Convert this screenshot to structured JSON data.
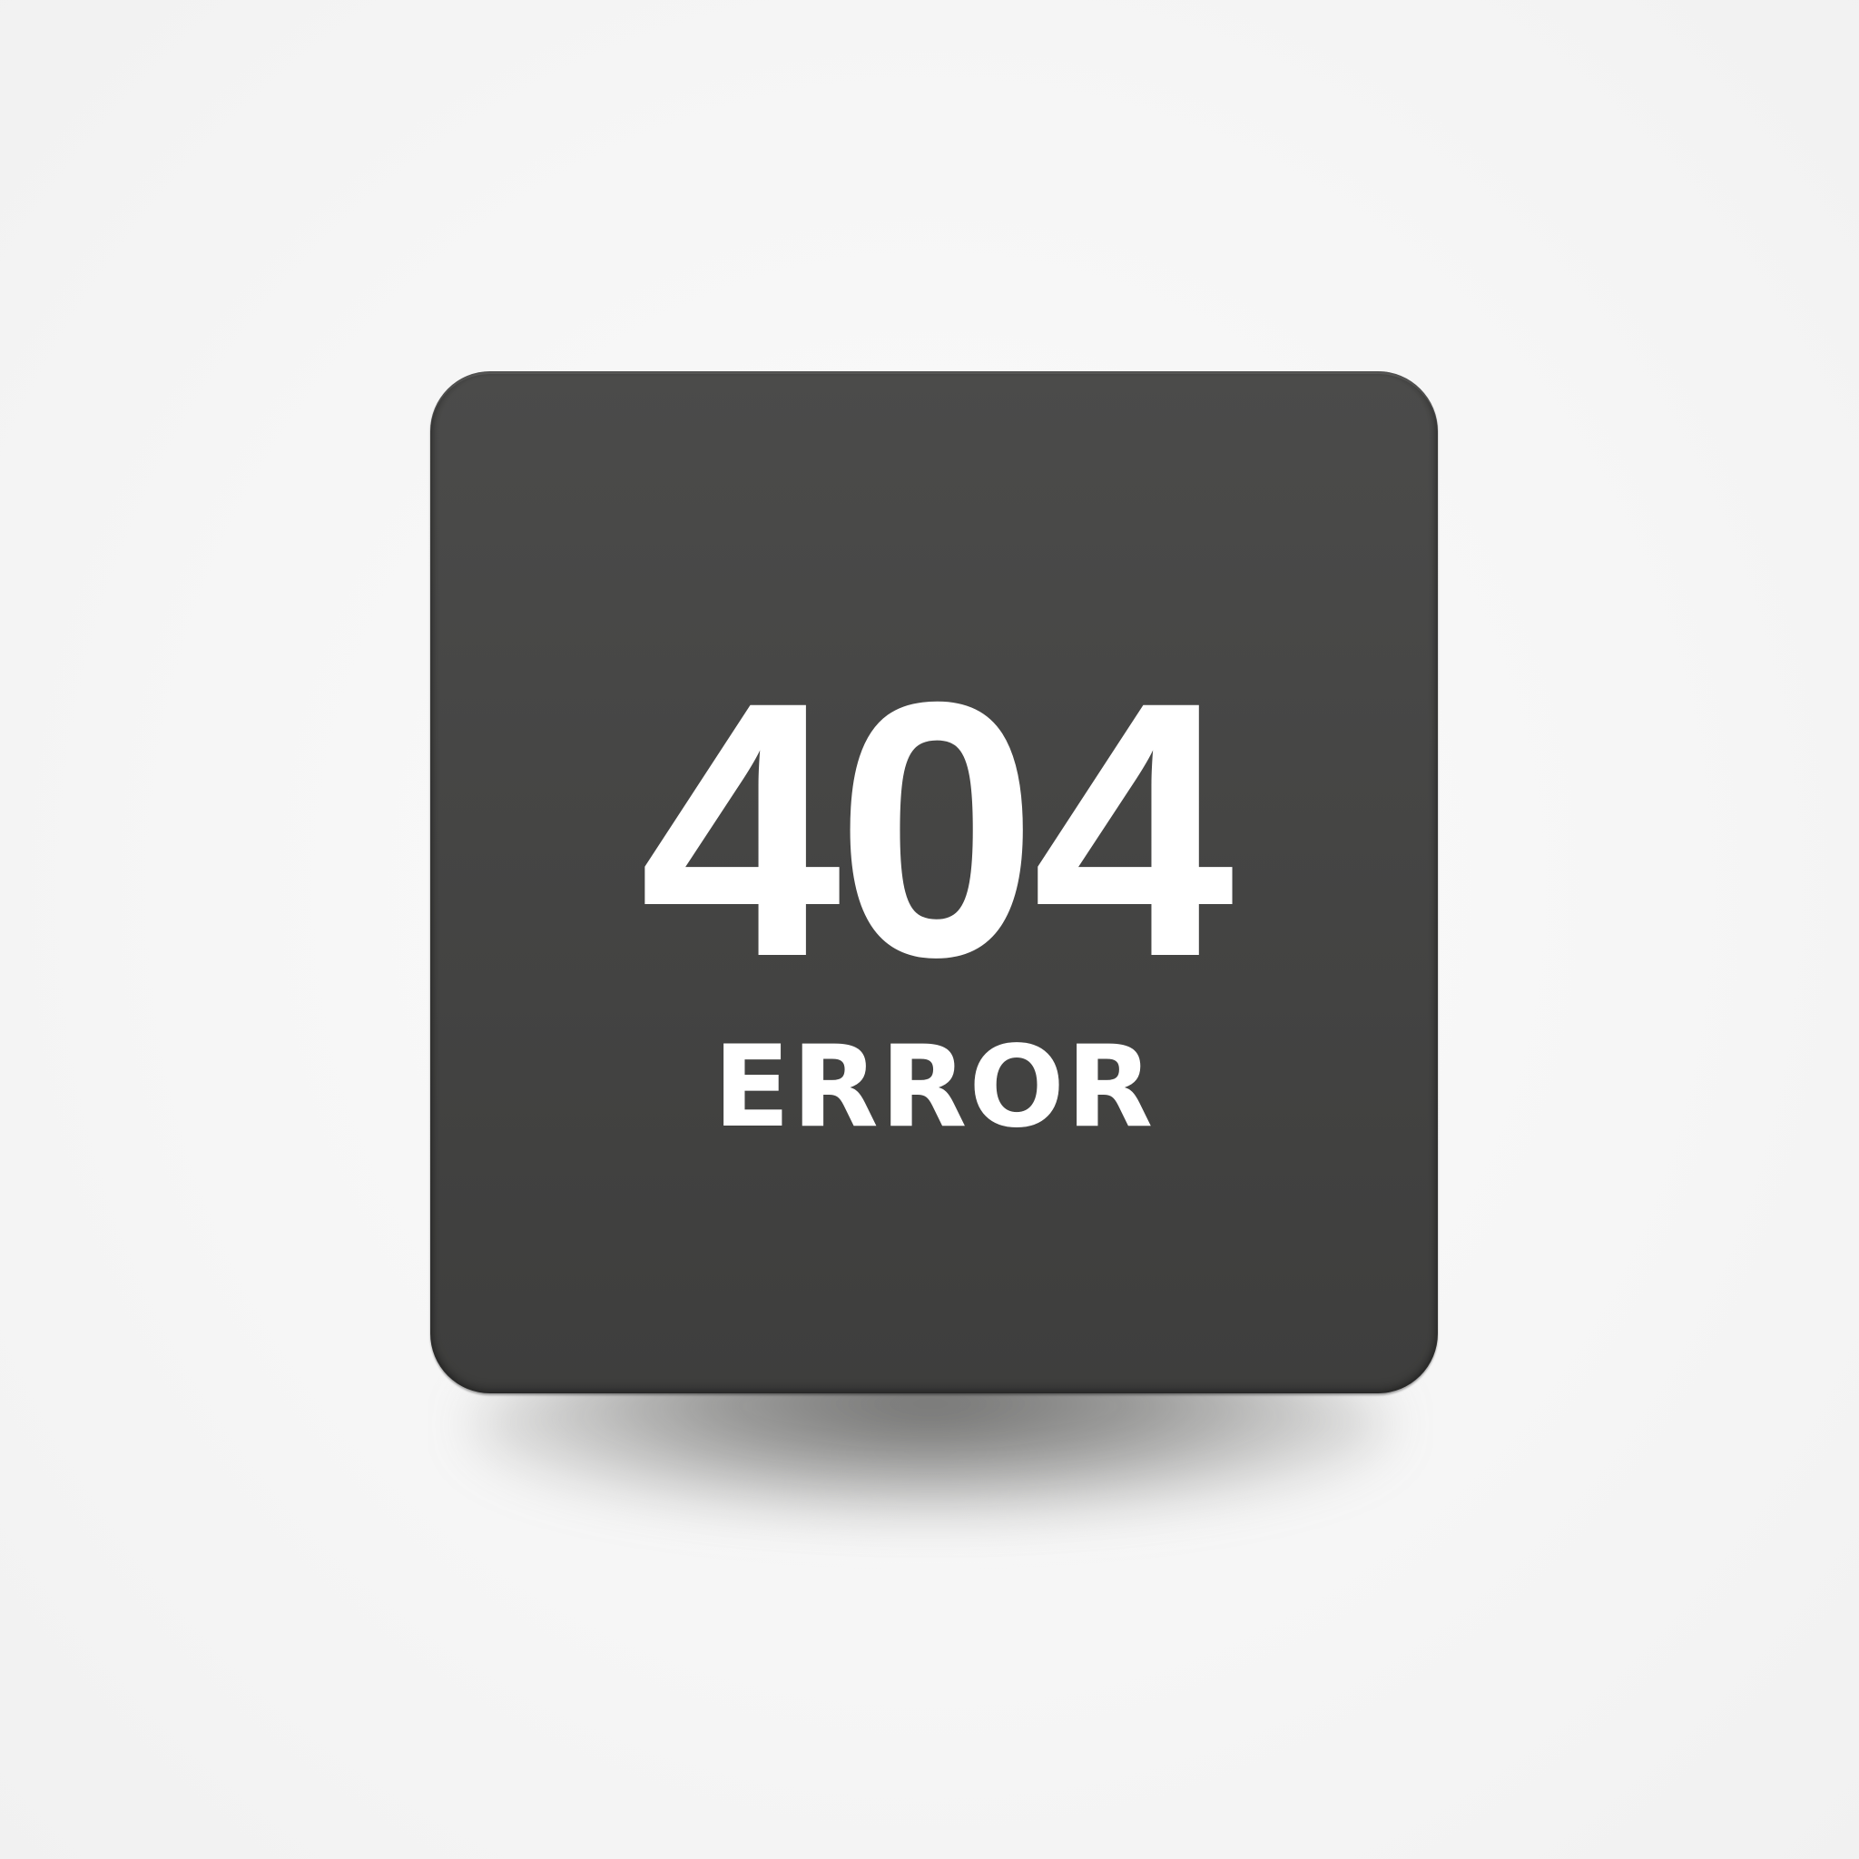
{
  "error_card": {
    "code": "404",
    "label": "ERROR"
  },
  "colors": {
    "background": "#f6f6f6",
    "card": "#454544",
    "text": "#ffffff"
  }
}
